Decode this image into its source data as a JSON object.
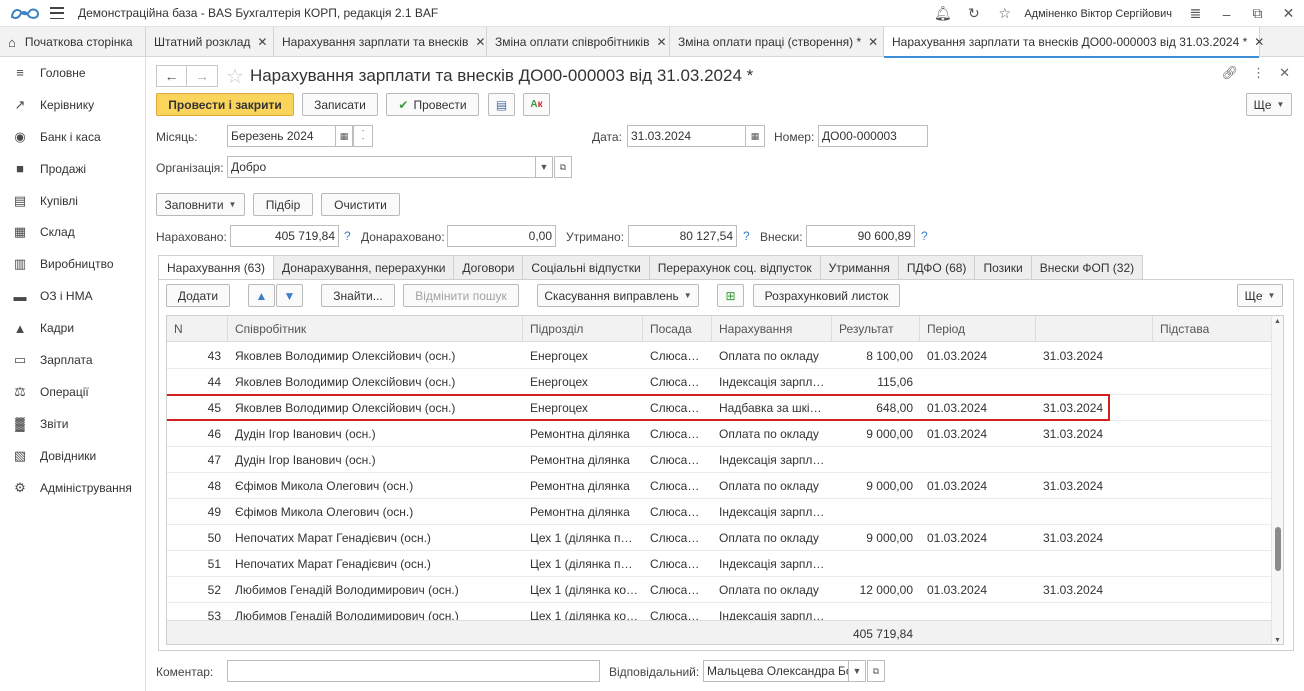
{
  "app": {
    "title": "Демонстраційна база - BAS Бухгалтерія КОРП, редакція 2.1 BAF",
    "user": "Адміненко Віктор Сергійович"
  },
  "tabs": [
    {
      "label": "Початкова сторінка"
    },
    {
      "label": "Штатний розклад"
    },
    {
      "label": "Нарахування зарплати та внесків"
    },
    {
      "label": "Зміна оплати співробітників"
    },
    {
      "label": "Зміна оплати праці (створення) *"
    },
    {
      "label": "Нарахування зарплати та внесків ДО00-000003 від 31.03.2024 *"
    }
  ],
  "sidebar": {
    "items": [
      {
        "label": "Головне",
        "icon": "menu-icon"
      },
      {
        "label": "Керівнику",
        "icon": "trend-icon"
      },
      {
        "label": "Банк і каса",
        "icon": "coin-icon"
      },
      {
        "label": "Продажі",
        "icon": "bag-icon"
      },
      {
        "label": "Купівлі",
        "icon": "cart-icon"
      },
      {
        "label": "Склад",
        "icon": "grid-icon"
      },
      {
        "label": "Виробництво",
        "icon": "factory-icon"
      },
      {
        "label": "ОЗ і НМА",
        "icon": "truck-icon"
      },
      {
        "label": "Кадри",
        "icon": "person-icon"
      },
      {
        "label": "Зарплата",
        "icon": "card-icon"
      },
      {
        "label": "Операції",
        "icon": "operations-icon"
      },
      {
        "label": "Звіти",
        "icon": "bar-chart-icon"
      },
      {
        "label": "Довідники",
        "icon": "book-icon"
      },
      {
        "label": "Адміністрування",
        "icon": "gear-icon"
      }
    ]
  },
  "document": {
    "title": "Нарахування зарплати та внесків ДО00-000003 від 31.03.2024 *",
    "more_label": "Ще",
    "buttons": {
      "post_close": "Провести і закрити",
      "save": "Записати",
      "post": "Провести"
    },
    "month_label": "Місяць:",
    "month_value": "Березень 2024",
    "date_label": "Дата:",
    "date_value": "31.03.2024",
    "number_label": "Номер:",
    "number_value": "ДО00-000003",
    "org_label": "Організація:",
    "org_value": "Добро",
    "fill_label": "Заповнити",
    "select_label": "Підбір",
    "clear_label": "Очистити",
    "accrued_label": "Нараховано:",
    "accrued_value": "405 719,84",
    "extra_label": "Донараховано:",
    "extra_value": "0,00",
    "withheld_label": "Утримано:",
    "withheld_value": "80 127,54",
    "contrib_label": "Внески:",
    "contrib_value": "90 600,89",
    "help_mark": "?",
    "comment_label": "Коментар:",
    "comment_value": "",
    "responsible_label": "Відповідальний:",
    "responsible_value": "Мальцева Олександра Бо"
  },
  "inner_tabs": [
    "Нарахування (63)",
    "Донарахування, перерахунки",
    "Договори",
    "Соціальні відпустки",
    "Перерахунок соц. відпусток",
    "Утримання",
    "ПДФО (68)",
    "Позики",
    "Внески ФОП (32)"
  ],
  "table_toolbar": {
    "add": "Додати",
    "find": "Знайти...",
    "cancel_search": "Відмінити пошук",
    "cancel_fixes": "Скасування виправлень",
    "calc_sheet": "Розрахунковий листок",
    "more": "Ще"
  },
  "table": {
    "columns": [
      "N",
      "Співробітник",
      "Підрозділ",
      "Посада",
      "Нарахування",
      "Результат",
      "Період",
      "",
      "Підстава"
    ],
    "rows": [
      {
        "n": "43",
        "employee": "Яковлев Володимир Олексійович (осн.)",
        "dept": "Енергоцех",
        "pos": "Слюса…",
        "accrual": "Оплата по окладу",
        "result": "8 100,00",
        "from": "01.03.2024",
        "to": "31.03.2024"
      },
      {
        "n": "44",
        "employee": "Яковлев Володимир Олексійович (осн.)",
        "dept": "Енергоцех",
        "pos": "Слюса…",
        "accrual": "Індексація зарпл…",
        "result": "115,06",
        "from": "",
        "to": ""
      },
      {
        "n": "45",
        "employee": "Яковлев Володимир Олексійович (осн.)",
        "dept": "Енергоцех",
        "pos": "Слюса…",
        "accrual": "Надбавка за шкі…",
        "result": "648,00",
        "from": "01.03.2024",
        "to": "31.03.2024"
      },
      {
        "n": "46",
        "employee": "Дудін Ігор Іванович (осн.)",
        "dept": "Ремонтна ділянка",
        "pos": "Слюса…",
        "accrual": "Оплата по окладу",
        "result": "9 000,00",
        "from": "01.03.2024",
        "to": "31.03.2024"
      },
      {
        "n": "47",
        "employee": "Дудін Ігор Іванович (осн.)",
        "dept": "Ремонтна ділянка",
        "pos": "Слюса…",
        "accrual": "Індексація зарпл…",
        "result": "",
        "from": "",
        "to": ""
      },
      {
        "n": "48",
        "employee": "Єфімов Микола Олегович (осн.)",
        "dept": "Ремонтна ділянка",
        "pos": "Слюса…",
        "accrual": "Оплата по окладу",
        "result": "9 000,00",
        "from": "01.03.2024",
        "to": "31.03.2024"
      },
      {
        "n": "49",
        "employee": "Єфімов Микола Олегович (осн.)",
        "dept": "Ремонтна ділянка",
        "pos": "Слюса…",
        "accrual": "Індексація зарпл…",
        "result": "",
        "from": "",
        "to": ""
      },
      {
        "n": "50",
        "employee": "Непочатих Марат Генадієвич (осн.)",
        "dept": "Цех 1 (ділянка п…",
        "pos": "Слюса…",
        "accrual": "Оплата по окладу",
        "result": "9 000,00",
        "from": "01.03.2024",
        "to": "31.03.2024"
      },
      {
        "n": "51",
        "employee": "Непочатих Марат Генадієвич (осн.)",
        "dept": "Цех 1 (ділянка п…",
        "pos": "Слюса…",
        "accrual": "Індексація зарпл…",
        "result": "",
        "from": "",
        "to": ""
      },
      {
        "n": "52",
        "employee": "Любимов Генадій Володимирович (осн.)",
        "dept": "Цех 1 (ділянка ко…",
        "pos": "Слюса…",
        "accrual": "Оплата по окладу",
        "result": "12 000,00",
        "from": "01.03.2024",
        "to": "31.03.2024"
      },
      {
        "n": "53",
        "employee": "Любимов Генадій Володимирович (осн.)",
        "dept": "Цех 1 (ділянка ко…",
        "pos": "Слюса…",
        "accrual": "Індексація зарпл…",
        "result": "",
        "from": "",
        "to": ""
      }
    ],
    "total": "405 719,84",
    "highlighted_row": "45"
  },
  "colors": {
    "primary_button": "#fbd55b",
    "highlight": "#d21f1f",
    "active_tab_line": "#3f8ed8"
  }
}
